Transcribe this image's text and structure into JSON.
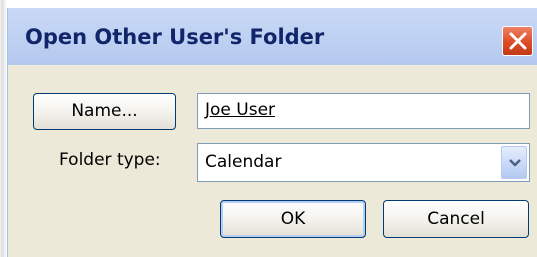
{
  "window": {
    "title": "Open Other User's Folder",
    "close_icon": "close-icon"
  },
  "name_button": {
    "label": "Name..."
  },
  "name_field": {
    "value": "Joe User"
  },
  "folder_type": {
    "label": "Folder type:",
    "selected": "Calendar",
    "dropdown_icon": "chevron-down-icon"
  },
  "buttons": {
    "ok": "OK",
    "cancel": "Cancel"
  },
  "colors": {
    "titlebar": "#bdd0f2",
    "title_text": "#11256a",
    "close_button": "#dc4b26",
    "dialog_background": "#ece9d8",
    "button_border": "#003c74",
    "field_border": "#7f9db9"
  }
}
